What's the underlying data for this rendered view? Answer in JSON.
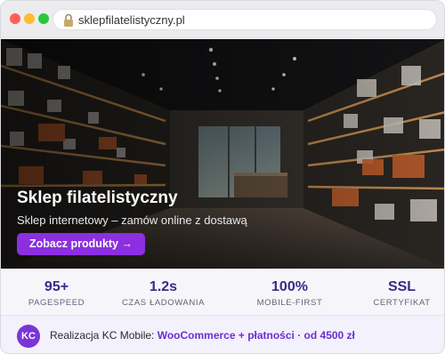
{
  "browser": {
    "url": "sklepfilatelistyczny.pl",
    "icons": {
      "lock": "lock-icon"
    },
    "traffic_lights": {
      "close": "#ff5f57",
      "minimize": "#febc2e",
      "maximize": "#28c840"
    }
  },
  "hero": {
    "title": "Sklep filatelistyczny",
    "subtitle": "Sklep internetowy – zamów online z dostawą",
    "cta_label": "Zobacz produkty →"
  },
  "stats": [
    {
      "value": "95+",
      "label": "PAGESPEED"
    },
    {
      "value": "1.2s",
      "label": "CZAS ŁADOWANIA"
    },
    {
      "value": "100%",
      "label": "MOBILE-FIRST"
    },
    {
      "value": "SSL",
      "label": "CERTYFIKAT"
    }
  ],
  "footer": {
    "avatar_initials": "KC",
    "text_prefix": "Realizacja KC Mobile: ",
    "text_highlight": "WooCommerce + płatności · od 4500 zł"
  },
  "colors": {
    "accent": "#8b2fe0",
    "stat_value": "#3b2a87",
    "avatar": "#7a35d6",
    "footer_highlight": "#6b2fd1"
  }
}
